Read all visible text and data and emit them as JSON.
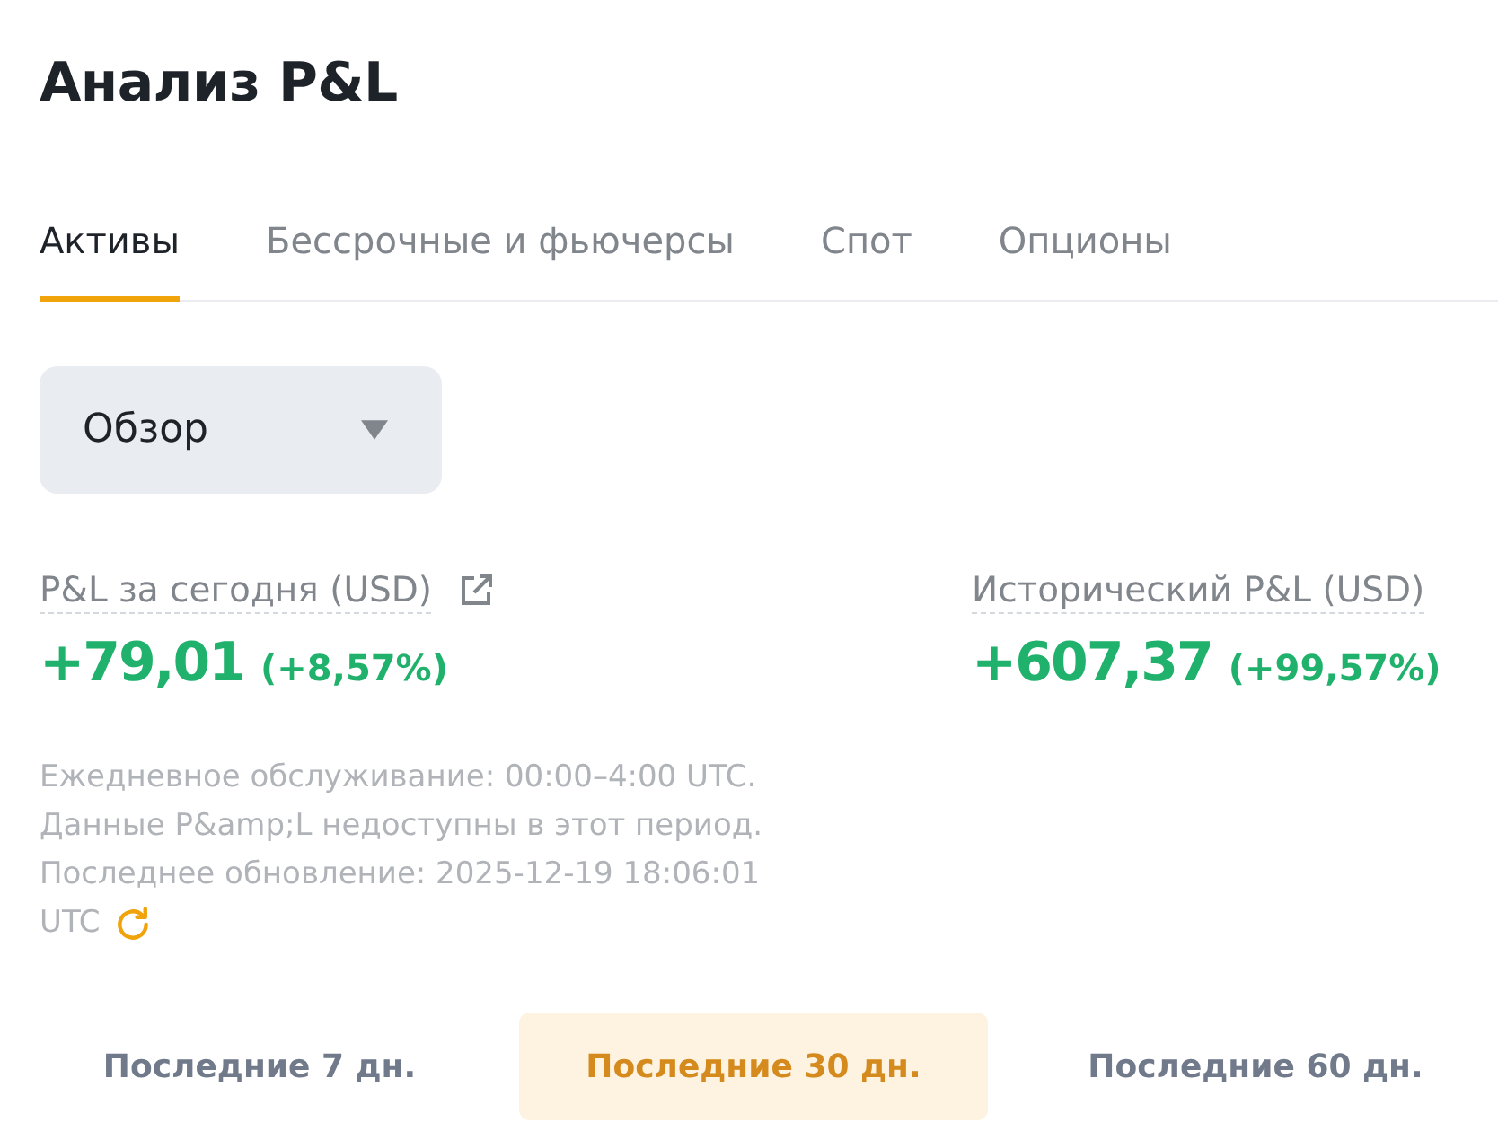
{
  "title": "Анализ P&L",
  "tabs": [
    {
      "label": "Активы",
      "selected": true
    },
    {
      "label": "Бессрочные и фьючерсы",
      "selected": false
    },
    {
      "label": "Спот",
      "selected": false
    },
    {
      "label": "Опционы",
      "selected": false
    }
  ],
  "view_select": {
    "value": "Обзор"
  },
  "metrics": [
    {
      "label": "P&L за сегодня (USD)",
      "linked": true,
      "value": "+79,01",
      "change": "(+8,57%)"
    },
    {
      "label": "Исторический P&L (USD)",
      "linked": false,
      "value": "+607,37",
      "change": "(+99,57%)"
    }
  ],
  "notice": {
    "maintenance": "Ежедневное обслуживание: 00:00–4:00 UTC.",
    "unavailable": "Данные P&amp;L недоступны в этот период.",
    "last_updated": "Последнее обновление: 2025-12-19 18:06:01",
    "timezone": "UTC"
  },
  "periods": [
    {
      "label": "Последние 7 дн.",
      "selected": false
    },
    {
      "label": "Последние 30 дн.",
      "selected": true
    },
    {
      "label": "Последние 60 дн.",
      "selected": false
    }
  ]
}
